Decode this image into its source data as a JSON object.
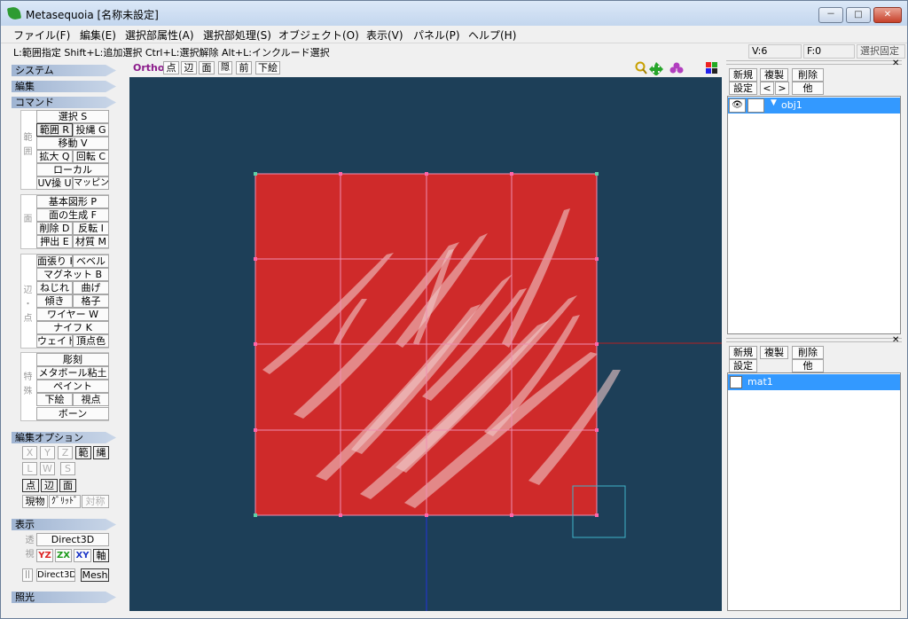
{
  "window": {
    "title": "Metasequoia [名称未設定]",
    "buttons": [
      "－",
      "□",
      "✕"
    ]
  },
  "menu": [
    {
      "label": "ファイル(F)"
    },
    {
      "label": "編集(E)"
    },
    {
      "label": "選択部属性(A)"
    },
    {
      "label": "選択部処理(S)"
    },
    {
      "label": "オブジェクト(O)"
    },
    {
      "label": "表示(V)"
    },
    {
      "label": "パネル(P)"
    },
    {
      "label": "ヘルプ(H)"
    }
  ],
  "status": {
    "hint": "L:範囲指定 Shift+L:追加選択 Ctrl+L:選択解除 Alt+L:インクルード選択",
    "vertices": "V:6",
    "faces": "F:0",
    "lock": "選択固定"
  },
  "left": {
    "sections": {
      "system": "システム",
      "edit": "編集",
      "command": "コマンド",
      "editopt": "編集オプション",
      "display": "表示",
      "light": "照光"
    },
    "group_labels": {
      "select": "範囲",
      "face": "面",
      "edge": "辺・点",
      "special": "特殊",
      "view": "透視"
    },
    "cmd": {
      "select": "選択 S",
      "range": "範囲 R",
      "rope": "投縄 G",
      "move": "移動 V",
      "scale": "拡大 Q",
      "rotate": "回転 C",
      "local": "ローカル",
      "uv": "UV操 U",
      "mapping": "マッピング",
      "primitive": "基本図形 P",
      "facegen": "面の生成 F",
      "delete": "削除 D",
      "flip": "反転 I",
      "extrude": "押出 E",
      "material": "材質 M",
      "stretch": "面張り H",
      "bevel": "ベベル",
      "magnet": "マグネット B",
      "twist": "ねじれ",
      "bend": "曲げ",
      "tilt": "傾き",
      "lattice": "格子",
      "wire": "ワイヤー W",
      "knife": "ナイフ K",
      "weight": "ウェイト",
      "vcolor": "頂点色",
      "sculpt": "彫刻",
      "metaball": "メタボール粘土",
      "paint": "ペイント",
      "underlay": "下絵",
      "viewpoint": "視点",
      "bone": "ボーン"
    },
    "opt": {
      "x": "X",
      "y": "Y",
      "z": "Z",
      "range": "範",
      "rope": "縄",
      "l": "L",
      "w": "W",
      "s": "S",
      "pt": "点",
      "ed": "辺",
      "fc": "面",
      "real": "現物",
      "grid": "ｸﾞﾘｯﾄﾞ",
      "sym": "対称"
    },
    "disp": {
      "d3d": "Direct3D",
      "yz": "YZ",
      "zx": "ZX",
      "xy": "XY",
      "axis": "軸",
      "d3d2": "Direct3D",
      "mesh": "Mesh"
    }
  },
  "viewtoolbar": {
    "ortho": "Ortho",
    "pt": "点",
    "ed": "辺",
    "fc": "面",
    "persp": "隠",
    "front": "前",
    "under": "下絵"
  },
  "objects": {
    "new": "新規",
    "copy": "複製",
    "del": "削除",
    "set": "設定",
    "prev": "<",
    "next": ">",
    "other": "他",
    "items": [
      {
        "name": "obj1"
      }
    ]
  },
  "materials": {
    "new": "新規",
    "copy": "複製",
    "del": "削除",
    "set": "設定",
    "other": "他",
    "items": [
      {
        "name": "mat1"
      }
    ]
  },
  "colors": {
    "viewport": "#1d3f58",
    "plane": "#cf2a2a",
    "grid": "#ee88aa",
    "selection": "#3399ff"
  }
}
